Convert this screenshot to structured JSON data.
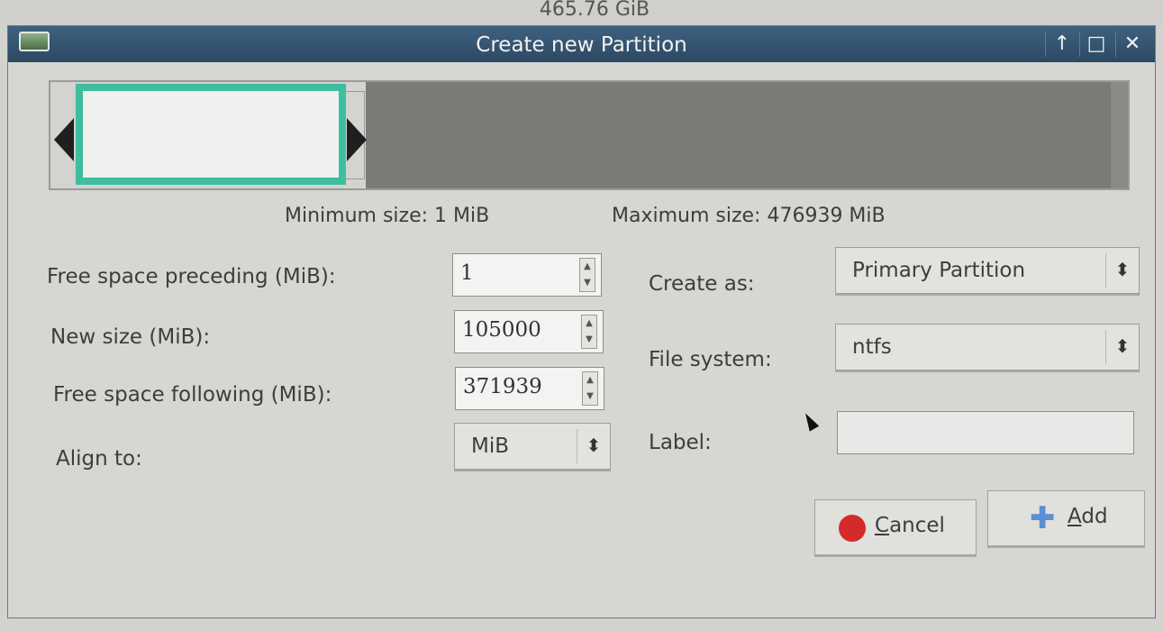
{
  "background": {
    "disk_size": "465.76 GiB"
  },
  "window": {
    "title": "Create new Partition",
    "controls": {
      "up": "↑",
      "maximize": "□",
      "close": "✕"
    }
  },
  "size_info": {
    "minimum": "Minimum size: 1 MiB",
    "maximum": "Maximum size: 476939 MiB"
  },
  "left_form": {
    "free_preceding": {
      "label": "Free space preceding (MiB):",
      "value": "1"
    },
    "new_size": {
      "label": "New size (MiB):",
      "value": "105000"
    },
    "free_following": {
      "label": "Free space following (MiB):",
      "value": "371939"
    },
    "align_to": {
      "label": "Align to:",
      "value": "MiB"
    }
  },
  "right_form": {
    "create_as": {
      "label": "Create as:",
      "value": "Primary Partition"
    },
    "file_system": {
      "label": "File system:",
      "value": "ntfs"
    },
    "label_field": {
      "label": "Label:",
      "value": ""
    }
  },
  "buttons": {
    "cancel": {
      "accel": "C",
      "rest": "ancel"
    },
    "add": {
      "accel": "A",
      "rest": "dd"
    }
  },
  "colors": {
    "titlebar": "#355673",
    "partition_border": "#3ebd9f",
    "cancel_icon": "#d42a2a",
    "add_icon": "#5b8fd6"
  }
}
